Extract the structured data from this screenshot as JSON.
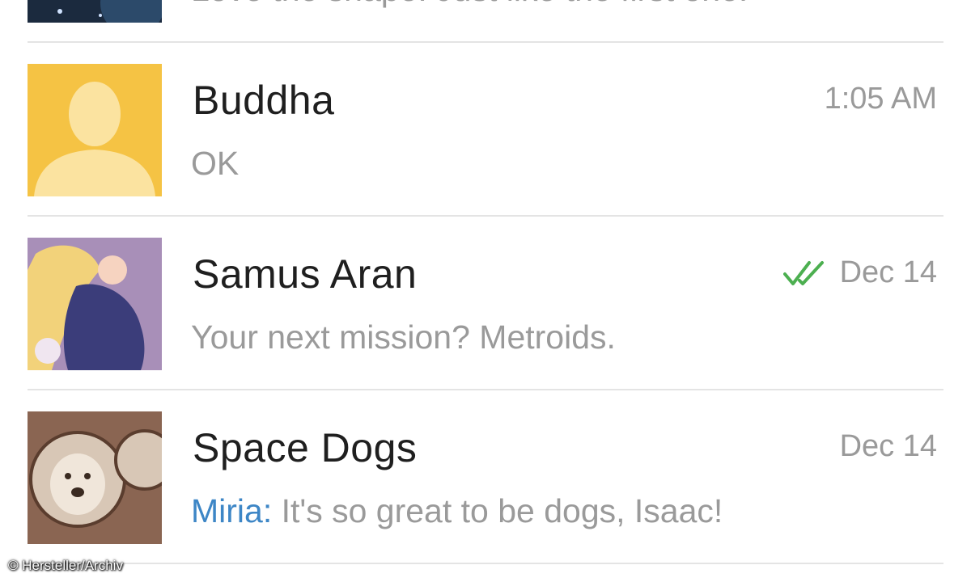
{
  "chats": [
    {
      "name": "",
      "preview_sender": "",
      "preview_text": "Love the shape. Just like the first one.",
      "time": "",
      "avatar_icon": "space-photo-avatar"
    },
    {
      "name": "Buddha",
      "preview_sender": "",
      "preview_text": "OK",
      "time": "1:05 AM",
      "avatar_icon": "default-person-avatar",
      "avatar_color": "#f5c344"
    },
    {
      "name": "Samus Aran",
      "preview_sender": "",
      "preview_text": "Your next mission? Metroids.",
      "time": "Dec 14",
      "read_status_icon": "double-check-icon",
      "read_status_color": "#4caf50",
      "avatar_icon": "anime-character-avatar"
    },
    {
      "name": "Space Dogs",
      "preview_sender": "Miria:",
      "preview_text": " It's so great to be dogs, Isaac!",
      "time": "Dec 14",
      "avatar_icon": "space-dog-avatar"
    }
  ],
  "watermark": "© Hersteller/Archiv"
}
